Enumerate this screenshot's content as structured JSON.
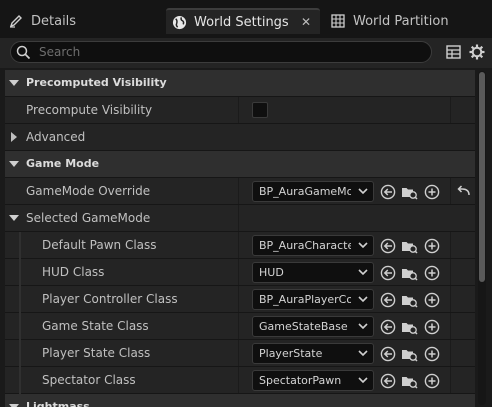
{
  "tabs": [
    {
      "label": "Details",
      "icon": "pencil-icon"
    },
    {
      "label": "World Settings",
      "icon": "globe-icon",
      "active": true
    },
    {
      "label": "World Partition",
      "icon": "grid-icon"
    }
  ],
  "tab_close_glyph": "✕",
  "search": {
    "placeholder": "Search",
    "value": ""
  },
  "toolbar_icons": [
    "table-view-icon",
    "settings-gear-icon"
  ],
  "rows": {
    "precomputed_visibility": "Precomputed Visibility",
    "precompute_visibility": "Precompute Visibility",
    "advanced": "Advanced",
    "game_mode": "Game Mode",
    "gamemode_override": {
      "label": "GameMode Override",
      "value": "BP_AuraGameMode"
    },
    "selected_gamemode": "Selected GameMode",
    "default_pawn_class": {
      "label": "Default Pawn Class",
      "value": "BP_AuraCharacter"
    },
    "hud_class": {
      "label": "HUD Class",
      "value": "HUD"
    },
    "player_controller_class": {
      "label": "Player Controller Class",
      "value": "BP_AuraPlayerController"
    },
    "game_state_class": {
      "label": "Game State Class",
      "value": "GameStateBase"
    },
    "player_state_class": {
      "label": "Player State Class",
      "value": "PlayerState"
    },
    "spectator_class": {
      "label": "Spectator Class",
      "value": "SpectatorPawn"
    },
    "lightmass": "Lightmass"
  },
  "colors": {
    "accent": "#1e90ff",
    "panel": "#242424",
    "category": "#2f2f2f",
    "text": "#c0c0c0"
  }
}
